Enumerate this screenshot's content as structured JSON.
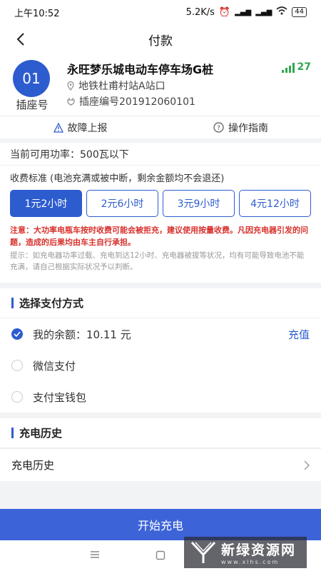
{
  "status_bar": {
    "time": "上午10:52",
    "speed": "5.2K/s",
    "battery": "44"
  },
  "nav": {
    "title": "付款"
  },
  "station": {
    "socket_number": "01",
    "socket_label": "插座号",
    "name": "永旺梦乐城电动车停车场G桩",
    "signal": "27",
    "address": "地铁杜甫村站A站口",
    "code": "插座编号201912060101"
  },
  "actions": {
    "report": "故障上报",
    "guide": "操作指南"
  },
  "power": {
    "text": "当前可用功率：500瓦以下"
  },
  "fee": {
    "title": "收费标准 (电池充满或被中断，剩余金额均不会退还)",
    "options": [
      {
        "label": "1元2小时",
        "selected": true
      },
      {
        "label": "2元6小时",
        "selected": false
      },
      {
        "label": "3元9小时",
        "selected": false
      },
      {
        "label": "4元12小时",
        "selected": false
      }
    ],
    "warning": "注意：大功率电瓶车按时收费可能会被拒充，建议使用按量收费。凡因充电器引发的问题，造成的后果均由车主自行承担。",
    "tip": "提示：如充电器功率过载、充电到达12小时、充电器被拔等状况，均有可能导致电池不能充满，请自己根据实际状况予以判断。"
  },
  "payment": {
    "section_title": "选择支付方式",
    "balance_label": "我的余额：10.11 元",
    "recharge": "充值",
    "wechat": "微信支付",
    "alipay": "支付宝钱包"
  },
  "history": {
    "section_title": "充电历史",
    "row_label": "充电历史"
  },
  "start_button": "开始充电",
  "watermark": {
    "big": "新绿资源网",
    "small": "www.xlhs.com"
  },
  "colors": {
    "primary": "#2d5ccf",
    "button": "#3d63d8",
    "warning": "#d8312c",
    "signal": "#2fa84f"
  }
}
